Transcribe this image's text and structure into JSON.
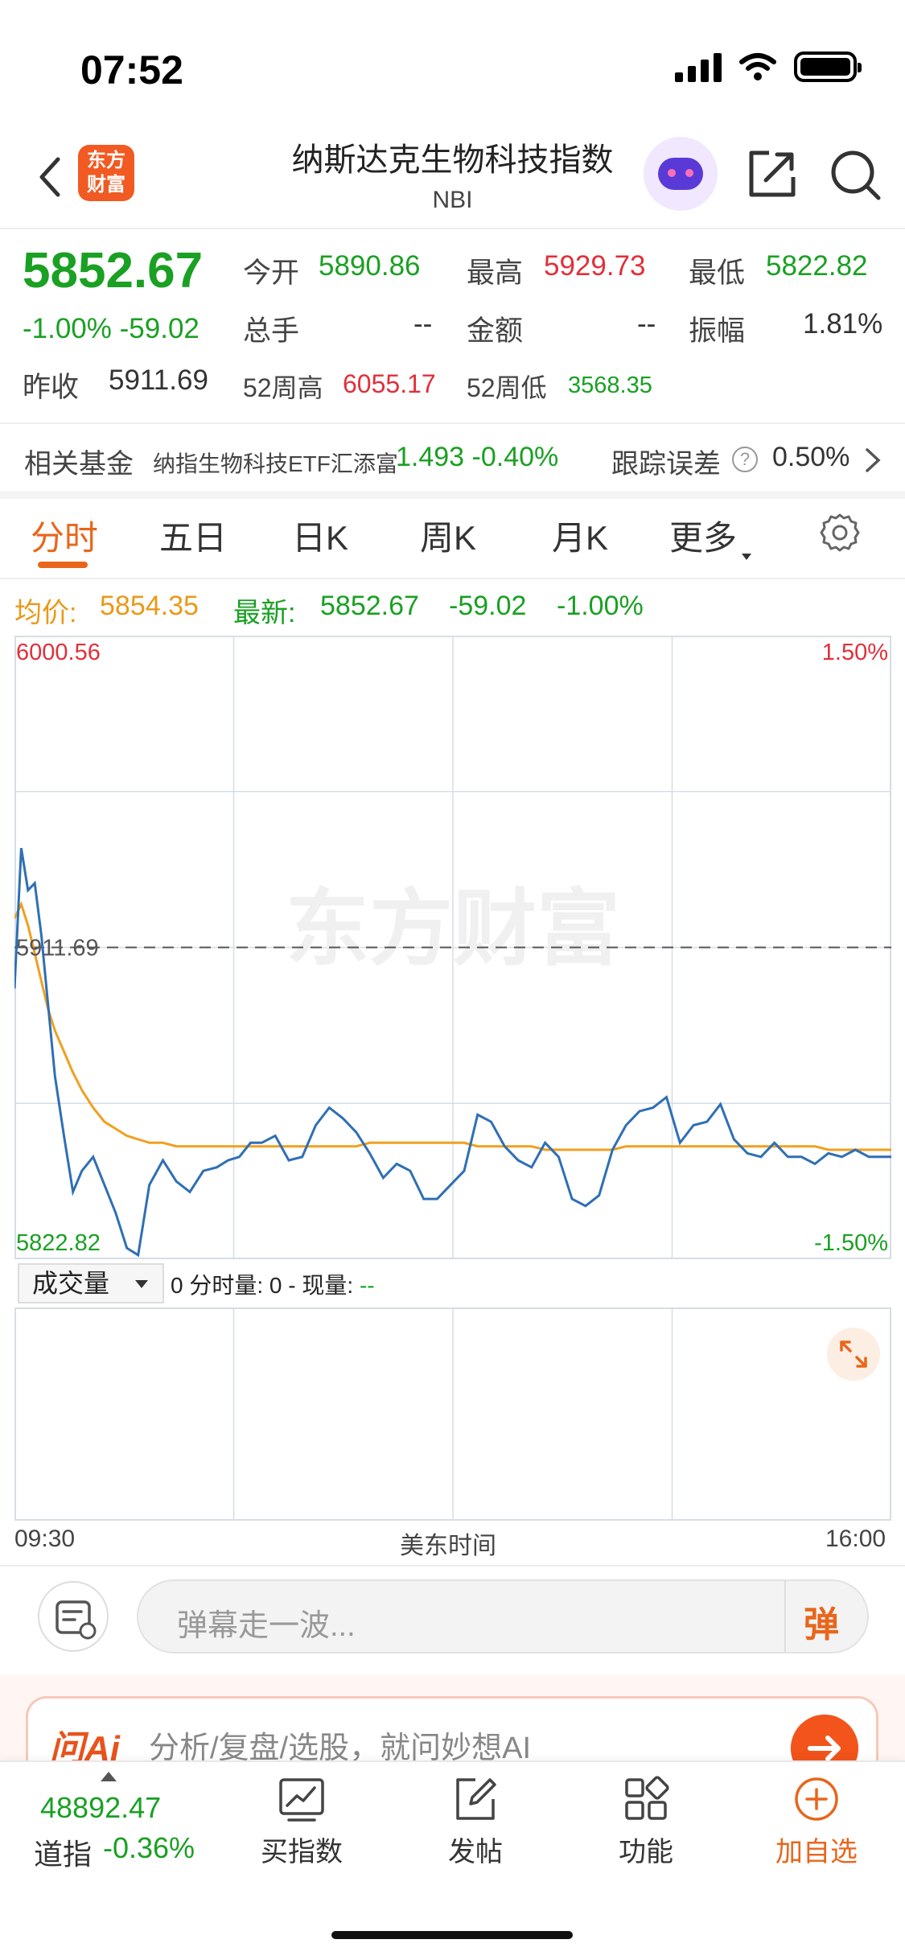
{
  "status_bar": {
    "time": "07:52"
  },
  "header": {
    "logo_line1": "东方",
    "logo_line2": "财富",
    "title": "纳斯达克生物科技指数",
    "subtitle": "NBI"
  },
  "quote": {
    "price": "5852.67",
    "change_pct": "-1.00%",
    "change_abs": "-59.02",
    "open_label": "今开",
    "open": "5890.86",
    "high_label": "最高",
    "high": "5929.73",
    "low_label": "最低",
    "low": "5822.82",
    "volume_label": "总手",
    "volume": "--",
    "amount_label": "金额",
    "amount": "--",
    "amplitude_label": "振幅",
    "amplitude": "1.81%",
    "prev_close_label": "昨收",
    "prev_close": "5911.69",
    "wk52_high_label": "52周高",
    "wk52_high": "6055.17",
    "wk52_low_label": "52周低",
    "wk52_low": "3568.35"
  },
  "related_fund": {
    "label": "相关基金",
    "name": "纳指生物科技ETF汇添富",
    "price": "1.493",
    "change": "-0.40%",
    "tracking_label": "跟踪误差",
    "tracking_value": "0.50%"
  },
  "tabs": [
    {
      "label": "分时",
      "active": true
    },
    {
      "label": "五日"
    },
    {
      "label": "日K"
    },
    {
      "label": "周K"
    },
    {
      "label": "月K"
    },
    {
      "label": "更多"
    }
  ],
  "summary": {
    "avg_label": "均价:",
    "avg_value": "5854.35",
    "latest_label": "最新:",
    "latest_value": "5852.67",
    "latest_change": "-59.02",
    "latest_pct": "-1.00%"
  },
  "chart_data": {
    "type": "line",
    "y_top_label": "6000.56",
    "y_bottom_label": "5822.82",
    "y_ref_label": "5911.69",
    "pct_top_label": "1.50%",
    "pct_bottom_label": "-1.50%",
    "watermark": "东方财富",
    "ylim": [
      5822.82,
      6000.56
    ],
    "reference": 5911.69,
    "x_start_label": "09:30",
    "x_end_label": "16:00",
    "x_axis_label": "美东时间",
    "x": [
      0,
      3,
      6,
      9,
      12,
      15,
      18,
      22,
      26,
      30,
      35,
      40,
      45,
      50,
      55,
      60,
      66,
      72,
      78,
      84,
      90,
      95,
      100,
      105,
      110,
      116,
      122,
      128,
      134,
      140,
      146,
      152,
      158,
      164,
      170,
      176,
      182,
      188,
      194,
      200,
      206,
      212,
      218,
      224,
      230,
      236,
      242,
      248,
      254,
      260,
      266,
      272,
      278,
      284,
      290,
      296,
      302,
      308,
      314,
      320,
      326,
      332,
      338,
      344,
      350,
      356,
      362,
      368,
      374,
      380,
      386,
      390
    ],
    "series": [
      {
        "name": "",
        "color": "#2f6fb5",
        "values": [
          5900,
          5940,
          5928,
          5930,
          5915,
          5895,
          5875,
          5858,
          5842,
          5848,
          5852,
          5844,
          5836,
          5826,
          5824,
          5844,
          5851,
          5845,
          5842,
          5848,
          5849,
          5851,
          5852,
          5856,
          5856,
          5858,
          5851,
          5852,
          5861,
          5866,
          5863,
          5859,
          5853,
          5846,
          5850,
          5848,
          5840,
          5840,
          5844,
          5848,
          5864,
          5862,
          5855,
          5851,
          5849,
          5856,
          5852,
          5840,
          5838,
          5841,
          5854,
          5861,
          5865,
          5866,
          5869,
          5856,
          5861,
          5862,
          5867,
          5857,
          5853,
          5852,
          5856,
          5852,
          5852,
          5850,
          5853,
          5852,
          5854,
          5852,
          5852,
          5852
        ]
      },
      {
        "name": "",
        "color": "#f0a020",
        "values": [
          5920,
          5924,
          5918,
          5910,
          5902,
          5894,
          5888,
          5882,
          5876,
          5871,
          5866,
          5862,
          5860,
          5858,
          5857,
          5856,
          5856,
          5855,
          5855,
          5855,
          5855,
          5855,
          5855,
          5855,
          5855,
          5855,
          5855,
          5855,
          5855,
          5855,
          5855,
          5855,
          5856,
          5856,
          5856,
          5856,
          5856,
          5856,
          5856,
          5856,
          5855,
          5855,
          5855,
          5855,
          5855,
          5854,
          5854,
          5854,
          5854,
          5854,
          5854,
          5855,
          5855,
          5855,
          5855,
          5855,
          5855,
          5855,
          5855,
          5855,
          5855,
          5855,
          5855,
          5855,
          5855,
          5855,
          5854,
          5854,
          5854,
          5854,
          5854,
          5854
        ]
      }
    ],
    "grid": true
  },
  "volume_panel": {
    "selector": "成交量",
    "text_prefix": "0 分时量: 0 - 现量: ",
    "text_current": "--"
  },
  "danmu": {
    "placeholder": "弹幕走一波...",
    "send_label": "弹"
  },
  "ai_bar": {
    "logo": "问Ai",
    "text": "分析/复盘/选股，就问妙想AI"
  },
  "bottom_bar": {
    "index_value": "48892.47",
    "index_name": "道指",
    "index_change": "-0.36%",
    "nav": [
      {
        "label": "买指数",
        "icon": "chart-trend-icon"
      },
      {
        "label": "发帖",
        "icon": "edit-icon"
      },
      {
        "label": "功能",
        "icon": "grid-icon"
      },
      {
        "label": "加自选",
        "icon": "plus-circle-icon"
      }
    ]
  },
  "colors": {
    "up": "#e0303a",
    "down": "#1aa023",
    "accent": "#e8661c",
    "price_line": "#2f6fb5",
    "avg_line": "#f0a020"
  }
}
